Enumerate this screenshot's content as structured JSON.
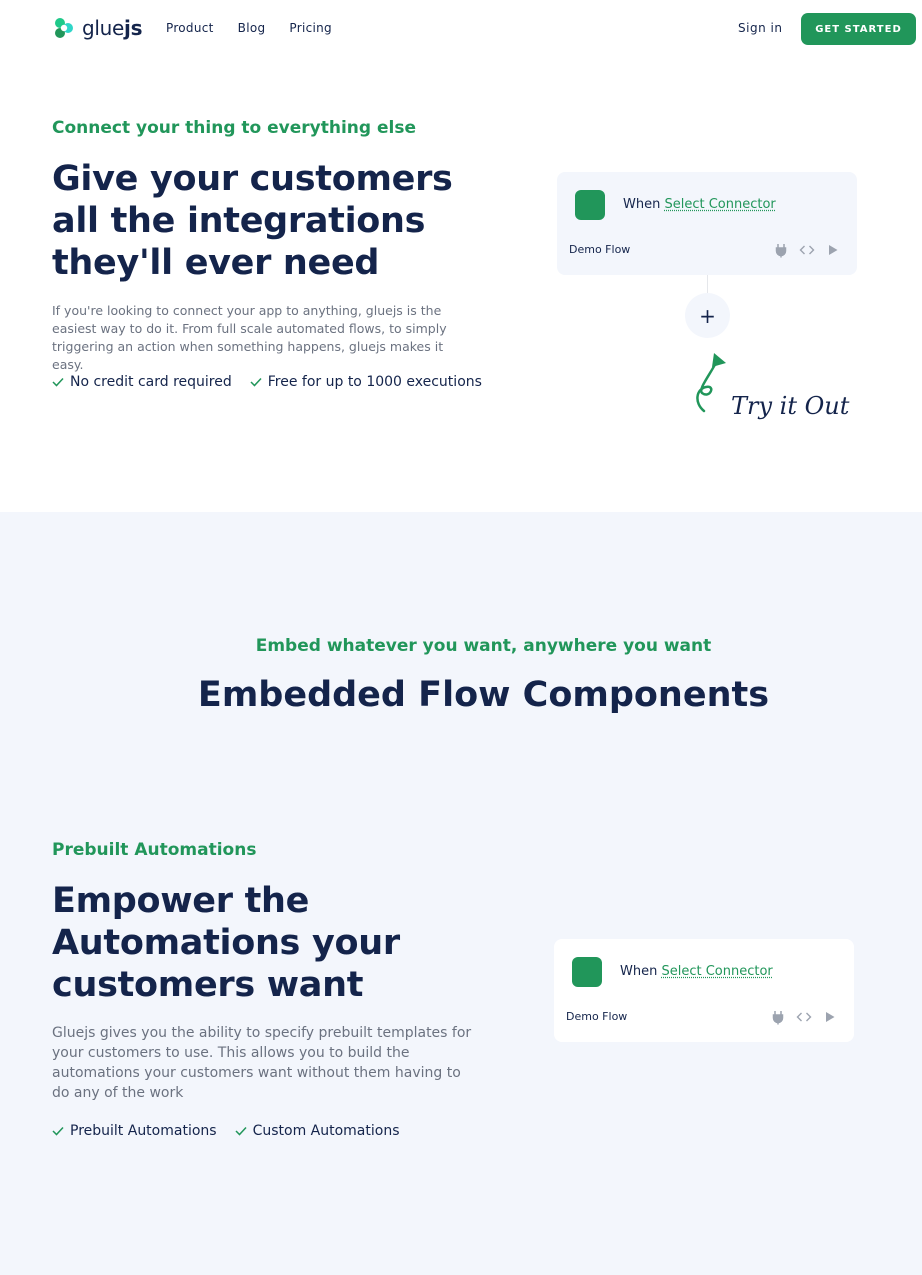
{
  "header": {
    "logo_prefix": "glue",
    "logo_suffix": "js",
    "nav": [
      "Product",
      "Blog",
      "Pricing"
    ],
    "sign_in": "Sign in",
    "cta": "GET STARTED"
  },
  "hero": {
    "eyebrow": "Connect your thing to everything else",
    "title": "Give your customers all the integrations they'll ever need",
    "description": "If you're looking to connect your app to anything, gluejs is the easiest way to do it. From full scale automated flows, to simply triggering an action when something happens, gluejs makes it easy.",
    "checks": [
      "No credit card required",
      "Free for up to 1000 executions"
    ],
    "flow": {
      "when": "When",
      "select": "Select Connector",
      "demo": "Demo Flow",
      "icons": [
        "plug-icon",
        "code-icon",
        "play-icon"
      ]
    },
    "plus": "+",
    "try_it": "Try it Out"
  },
  "embed": {
    "eyebrow": "Embed whatever you want, anywhere you want",
    "title": "Embedded Flow Components"
  },
  "automations": {
    "eyebrow": "Prebuilt Automations",
    "title": "Empower the Automations your customers want",
    "description": "Gluejs gives you the ability to specify prebuilt templates for your customers to use. This allows you to build the automations your customers want without them having to do any of the work",
    "checks": [
      "Prebuilt Automations",
      "Custom Automations"
    ],
    "flow": {
      "when": "When",
      "select": "Select Connector",
      "demo": "Demo Flow"
    }
  },
  "colors": {
    "brand_green": "#21965a",
    "navy": "#14244b",
    "section_bg": "#f3f6fc"
  }
}
